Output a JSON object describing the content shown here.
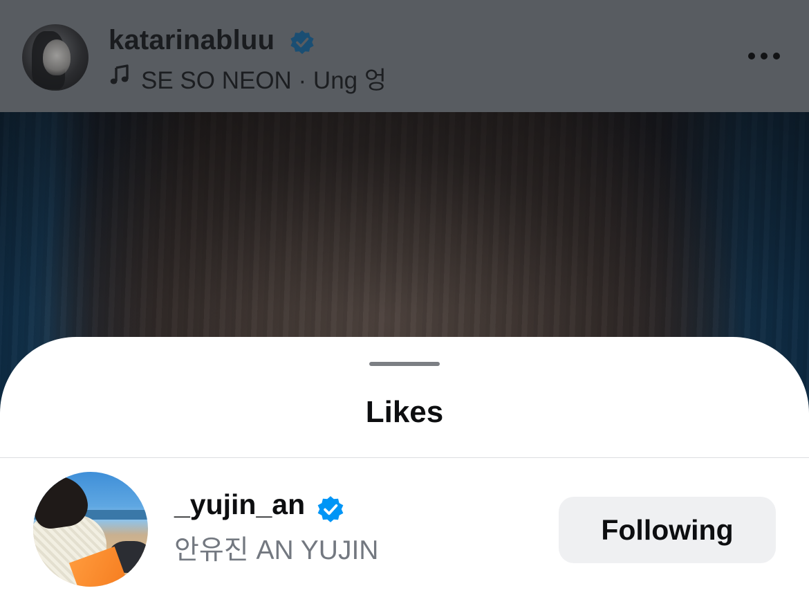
{
  "post": {
    "author_username": "katarinabluu",
    "song": "SE SO NEON · Ung 엉",
    "icons": {
      "verified": "verified-badge-icon",
      "music": "music-note-icon",
      "more": "more-options-icon"
    }
  },
  "likes_sheet": {
    "title": "Likes",
    "users": [
      {
        "username": "_yujin_an",
        "full_name": "안유진 AN YUJIN",
        "verified": true,
        "action_label": "Following"
      }
    ]
  },
  "colors": {
    "verified_blue": "#0095f6",
    "verified_blue_dimmed": "#1a4e73",
    "button_bg": "#eff0f2",
    "secondary_text": "#737880"
  }
}
